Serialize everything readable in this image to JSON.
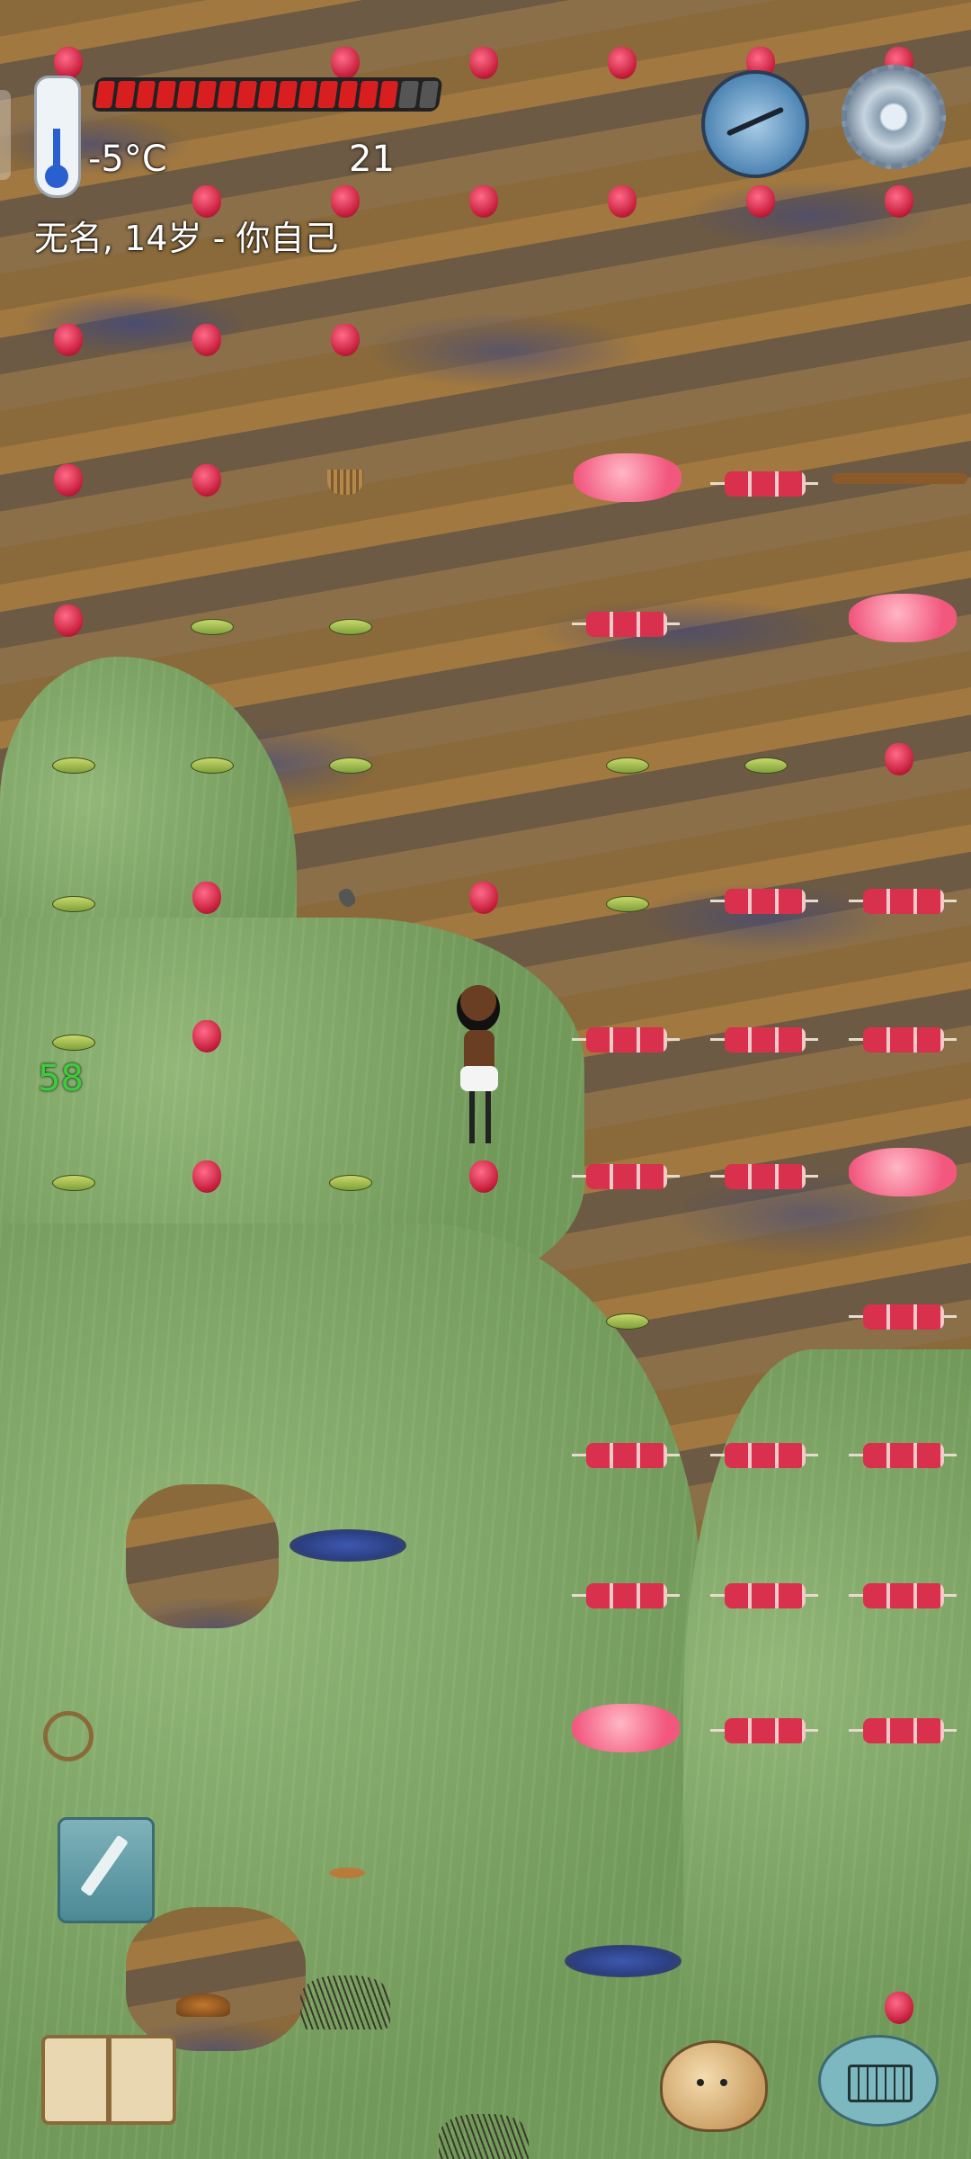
{
  "hud": {
    "temperature": "-5°C",
    "food_count": "21",
    "food_bar": {
      "filled_segments": 15,
      "total_segments": 17
    },
    "player_line": "无名, 14岁 - 你自己",
    "floating_number": "58"
  },
  "icons": {
    "thermometer": "thermometer-icon",
    "compass": "compass-icon",
    "settings": "gear-icon",
    "pencil": "pencil-icon",
    "book": "book-icon",
    "potato": "potato-icon",
    "keyboard": "keyboard-icon"
  },
  "colors": {
    "food_fill": "#d81e1e",
    "food_empty": "#555555",
    "temperature_text": "#ffffff",
    "floating_number": "#3dcc3d"
  }
}
